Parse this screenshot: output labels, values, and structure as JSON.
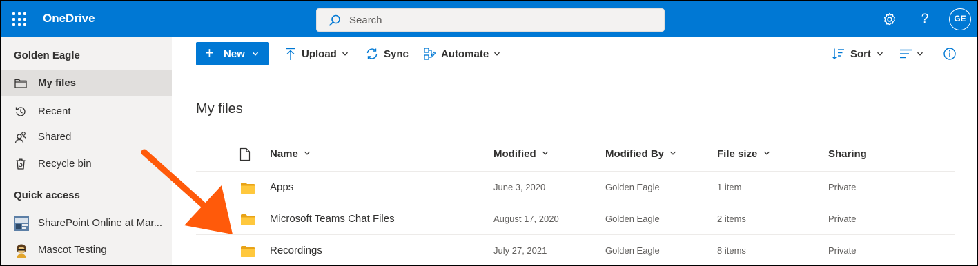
{
  "topbar": {
    "brand": "OneDrive",
    "search_placeholder": "Search",
    "avatar_initials": "GE",
    "help_glyph": "?",
    "accent": "#0078d4"
  },
  "sidebar": {
    "user": "Golden Eagle",
    "items": [
      {
        "label": "My files",
        "icon": "folder-icon",
        "active": true
      },
      {
        "label": "Recent",
        "icon": "history-icon"
      },
      {
        "label": "Shared",
        "icon": "people-icon"
      },
      {
        "label": "Recycle bin",
        "icon": "recycle-bin-icon"
      }
    ],
    "quick_access_label": "Quick access",
    "quick_access": [
      {
        "label": "SharePoint Online at Mar..."
      },
      {
        "label": "Mascot Testing"
      }
    ]
  },
  "commandbar": {
    "new": "New",
    "upload": "Upload",
    "sync": "Sync",
    "automate": "Automate",
    "sort": "Sort"
  },
  "main": {
    "title": "My files",
    "columns": {
      "name": "Name",
      "modified": "Modified",
      "modified_by": "Modified By",
      "file_size": "File size",
      "sharing": "Sharing"
    },
    "rows": [
      {
        "name": "Apps",
        "modified": "June 3, 2020",
        "modified_by": "Golden Eagle",
        "size": "1 item",
        "sharing": "Private"
      },
      {
        "name": "Microsoft Teams Chat Files",
        "modified": "August 17, 2020",
        "modified_by": "Golden Eagle",
        "size": "2 items",
        "sharing": "Private"
      },
      {
        "name": "Recordings",
        "modified": "July 27, 2021",
        "modified_by": "Golden Eagle",
        "size": "8 items",
        "sharing": "Private"
      }
    ]
  },
  "annotation": {
    "arrow_color": "#ff5a0a"
  }
}
